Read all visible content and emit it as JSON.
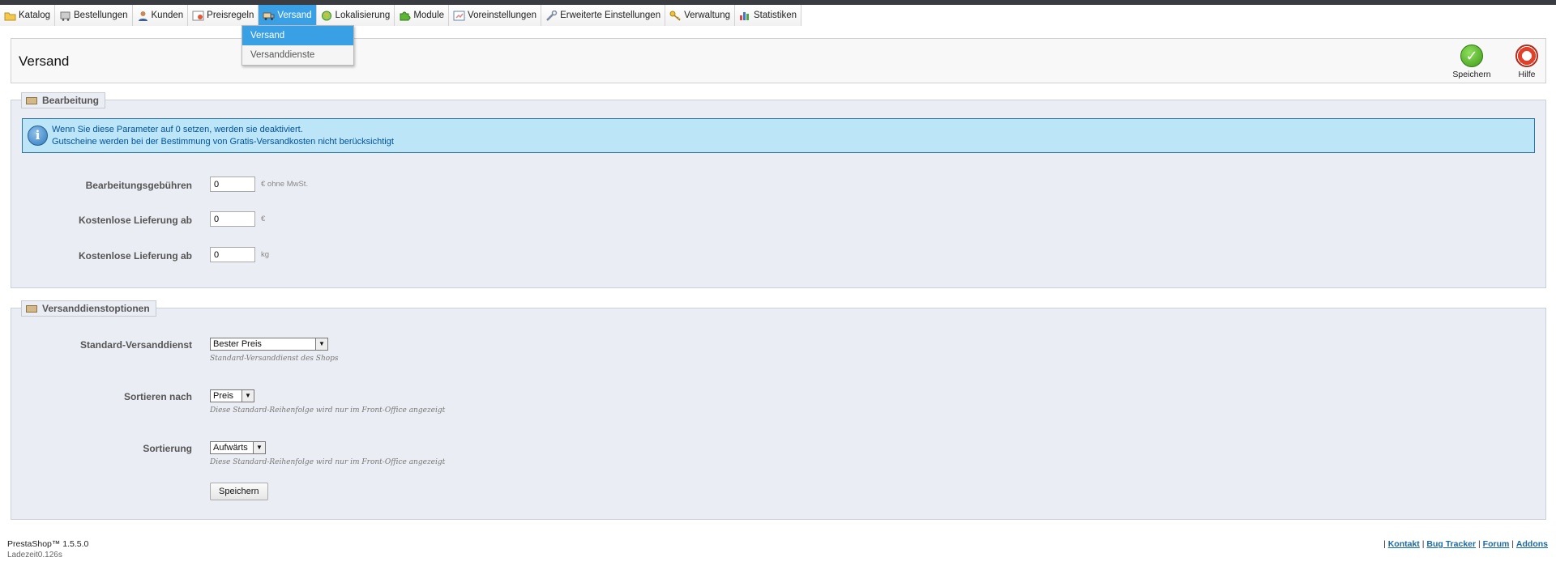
{
  "menu": [
    {
      "label": "Katalog",
      "icon": "folder-icon",
      "active": false
    },
    {
      "label": "Bestellungen",
      "icon": "cart-icon",
      "active": false
    },
    {
      "label": "Kunden",
      "icon": "user-icon",
      "active": false
    },
    {
      "label": "Preisregeln",
      "icon": "price-rule-icon",
      "active": false
    },
    {
      "label": "Versand",
      "icon": "truck-icon",
      "active": true
    },
    {
      "label": "Lokalisierung",
      "icon": "globe-icon",
      "active": false
    },
    {
      "label": "Module",
      "icon": "puzzle-icon",
      "active": false
    },
    {
      "label": "Voreinstellungen",
      "icon": "preferences-icon",
      "active": false
    },
    {
      "label": "Erweiterte Einstellungen",
      "icon": "wrench-icon",
      "active": false
    },
    {
      "label": "Verwaltung",
      "icon": "key-icon",
      "active": false
    },
    {
      "label": "Statistiken",
      "icon": "stats-icon",
      "active": false
    }
  ],
  "dropdown": {
    "items": [
      "Versand",
      "Versanddienste"
    ]
  },
  "page": {
    "title": "Versand",
    "save_label": "Speichern",
    "help_label": "Hilfe"
  },
  "handling": {
    "legend": "Bearbeitung",
    "info_line1": "Wenn Sie diese Parameter auf 0 setzen, werden sie deaktiviert.",
    "info_line2": "Gutscheine werden bei der Bestimmung von Gratis-Versandkosten nicht berücksichtigt",
    "fields": [
      {
        "label": "Bearbeitungsgebühren",
        "value": "0",
        "unit": "€ ohne MwSt."
      },
      {
        "label": "Kostenlose Lieferung ab",
        "value": "0",
        "unit": "€"
      },
      {
        "label": "Kostenlose Lieferung ab",
        "value": "0",
        "unit": "kg"
      }
    ]
  },
  "carrier_options": {
    "legend": "Versanddienstoptionen",
    "default_carrier": {
      "label": "Standard-Versanddienst",
      "selected": "Bester Preis",
      "hint": "Standard-Versanddienst des Shops"
    },
    "sort_by": {
      "label": "Sortieren nach",
      "selected": "Preis",
      "hint": "Diese Standard-Reihenfolge wird nur im Front-Office angezeigt"
    },
    "sort_order": {
      "label": "Sortierung",
      "selected": "Aufwärts",
      "hint": "Diese Standard-Reihenfolge wird nur im Front-Office angezeigt"
    },
    "save_label": "Speichern"
  },
  "footer": {
    "version": "PrestaShop™ 1.5.5.0",
    "load_time": "Ladezeit0.126s",
    "links": [
      "Kontakt",
      "Bug Tracker",
      "Forum",
      "Addons"
    ]
  }
}
